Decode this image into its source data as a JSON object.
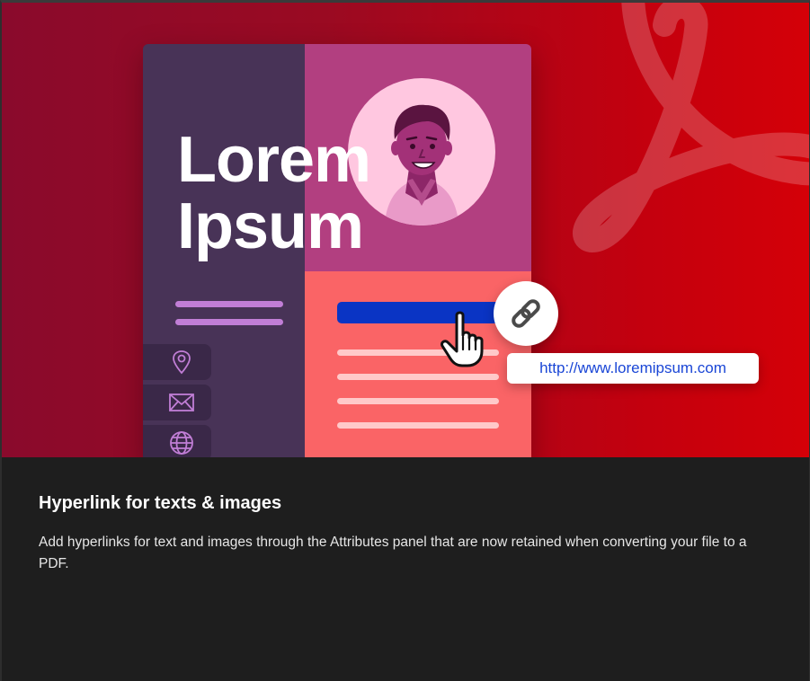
{
  "hero": {
    "card_title_line1": "Lorem",
    "card_title_line2": "Ipsum",
    "url": "http://www.loremipsum.com",
    "icons": [
      "location-pin-icon",
      "envelope-icon",
      "globe-icon",
      "chain-link-icon",
      "hand-pointer-icon",
      "acrobat-logo"
    ],
    "colors": {
      "background_start": "#8a0a2c",
      "background_end": "#d40008",
      "card_sidebar": "#483357",
      "card_header": "#b23f80",
      "card_body": "#fa6466",
      "link_bar": "#0a34c4",
      "url_text": "#1a46d6"
    }
  },
  "caption": {
    "title": "Hyperlink for texts & images",
    "description": "Add hyperlinks for text and images through the Attributes panel that are now retained when converting your file to a PDF."
  }
}
